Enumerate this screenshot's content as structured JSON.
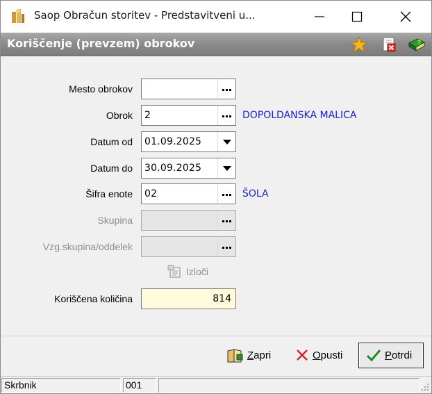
{
  "window": {
    "title": "Saop Obračun storitev - Predstavitveni u..."
  },
  "header": {
    "title": "Koriščenje (prevzem) obrokov"
  },
  "form": {
    "mesto_obrokov": {
      "label": "Mesto obrokov",
      "value": ""
    },
    "obrok": {
      "label": "Obrok",
      "value": "2",
      "description": "DOPOLDANSKA MALICA"
    },
    "datum_od": {
      "label": "Datum od",
      "value": "01.09.2025"
    },
    "datum_do": {
      "label": "Datum do",
      "value": "30.09.2025"
    },
    "sifra_enote": {
      "label": "Šifra enote",
      "value": "02",
      "description": "ŠOLA"
    },
    "skupina": {
      "label": "Skupina",
      "value": ""
    },
    "vzg_skupina": {
      "label": "Vzg.skupina/oddelek",
      "value": ""
    },
    "izloci": {
      "label": "Izloči"
    },
    "koriscena_kolicina": {
      "label": "Koriščena količina",
      "value": "814"
    }
  },
  "buttons": {
    "zapri": {
      "mnemonic": "Z",
      "rest": "apri"
    },
    "opusti": {
      "mnemonic": "O",
      "rest": "pusti"
    },
    "potrdi": {
      "mnemonic": "P",
      "rest": "otrdi"
    }
  },
  "status": {
    "user": "Skrbnik",
    "code": "001",
    "extra": ""
  },
  "colors": {
    "header_band": "#8a8a8a",
    "description_text": "#1f1fd0",
    "quantity_field": "#fffbdc",
    "disabled_field": "#e6e6e6"
  },
  "icons": {
    "app": "app-icon",
    "star": "favorite-star-icon",
    "close_report": "close-document-icon",
    "help": "help-book-icon",
    "zapri": "close-book-icon",
    "opusti": "x-icon",
    "potrdi": "checkmark-icon",
    "izloci": "exclude-icon"
  }
}
